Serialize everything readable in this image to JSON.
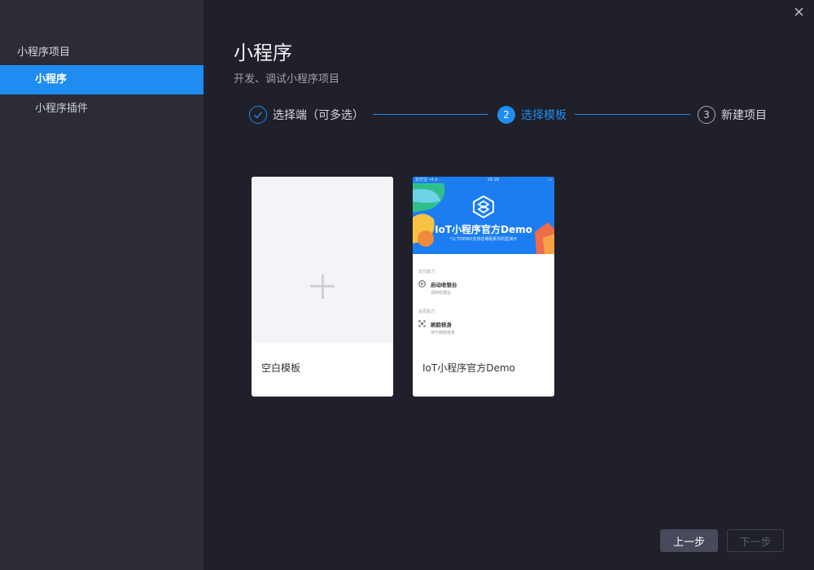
{
  "sidebar": {
    "section_title": "小程序项目",
    "items": [
      {
        "label": "小程序",
        "active": true
      },
      {
        "label": "小程序插件",
        "active": false
      }
    ]
  },
  "window": {
    "close_icon": "close-icon"
  },
  "header": {
    "title": "小程序",
    "subtitle": "开发、调试小程序项目"
  },
  "steps": [
    {
      "index": "✓",
      "label": "选择端（可多选）",
      "state": "done"
    },
    {
      "index": "2",
      "label": "选择模板",
      "state": "current"
    },
    {
      "index": "3",
      "label": "新建项目",
      "state": "pending"
    }
  ],
  "templates": [
    {
      "name": "空白模板",
      "icon": "plus-icon"
    },
    {
      "name": "IoT小程序官方Demo",
      "preview": {
        "status_left": "支付宝 ⁠•ıl ≋",
        "status_center": "19:18",
        "status_right": "▭",
        "title": "IoT小程序官方Demo",
        "subtitle": "*以下DEMO支持在蜻蜓系列机型演示",
        "sections": [
          {
            "heading": "支付能力",
            "item_title": "启动收银台",
            "item_desc": "调用收银台"
          },
          {
            "heading": "会员能力",
            "item_title": "刷脸核身",
            "item_desc": "用于刷脸核身"
          }
        ]
      }
    }
  ],
  "footer": {
    "prev_label": "上一步",
    "next_label": "下一步"
  },
  "colors": {
    "accent": "#1e8cf0",
    "background": "#1f2029",
    "sidebar": "#2b2c36"
  }
}
